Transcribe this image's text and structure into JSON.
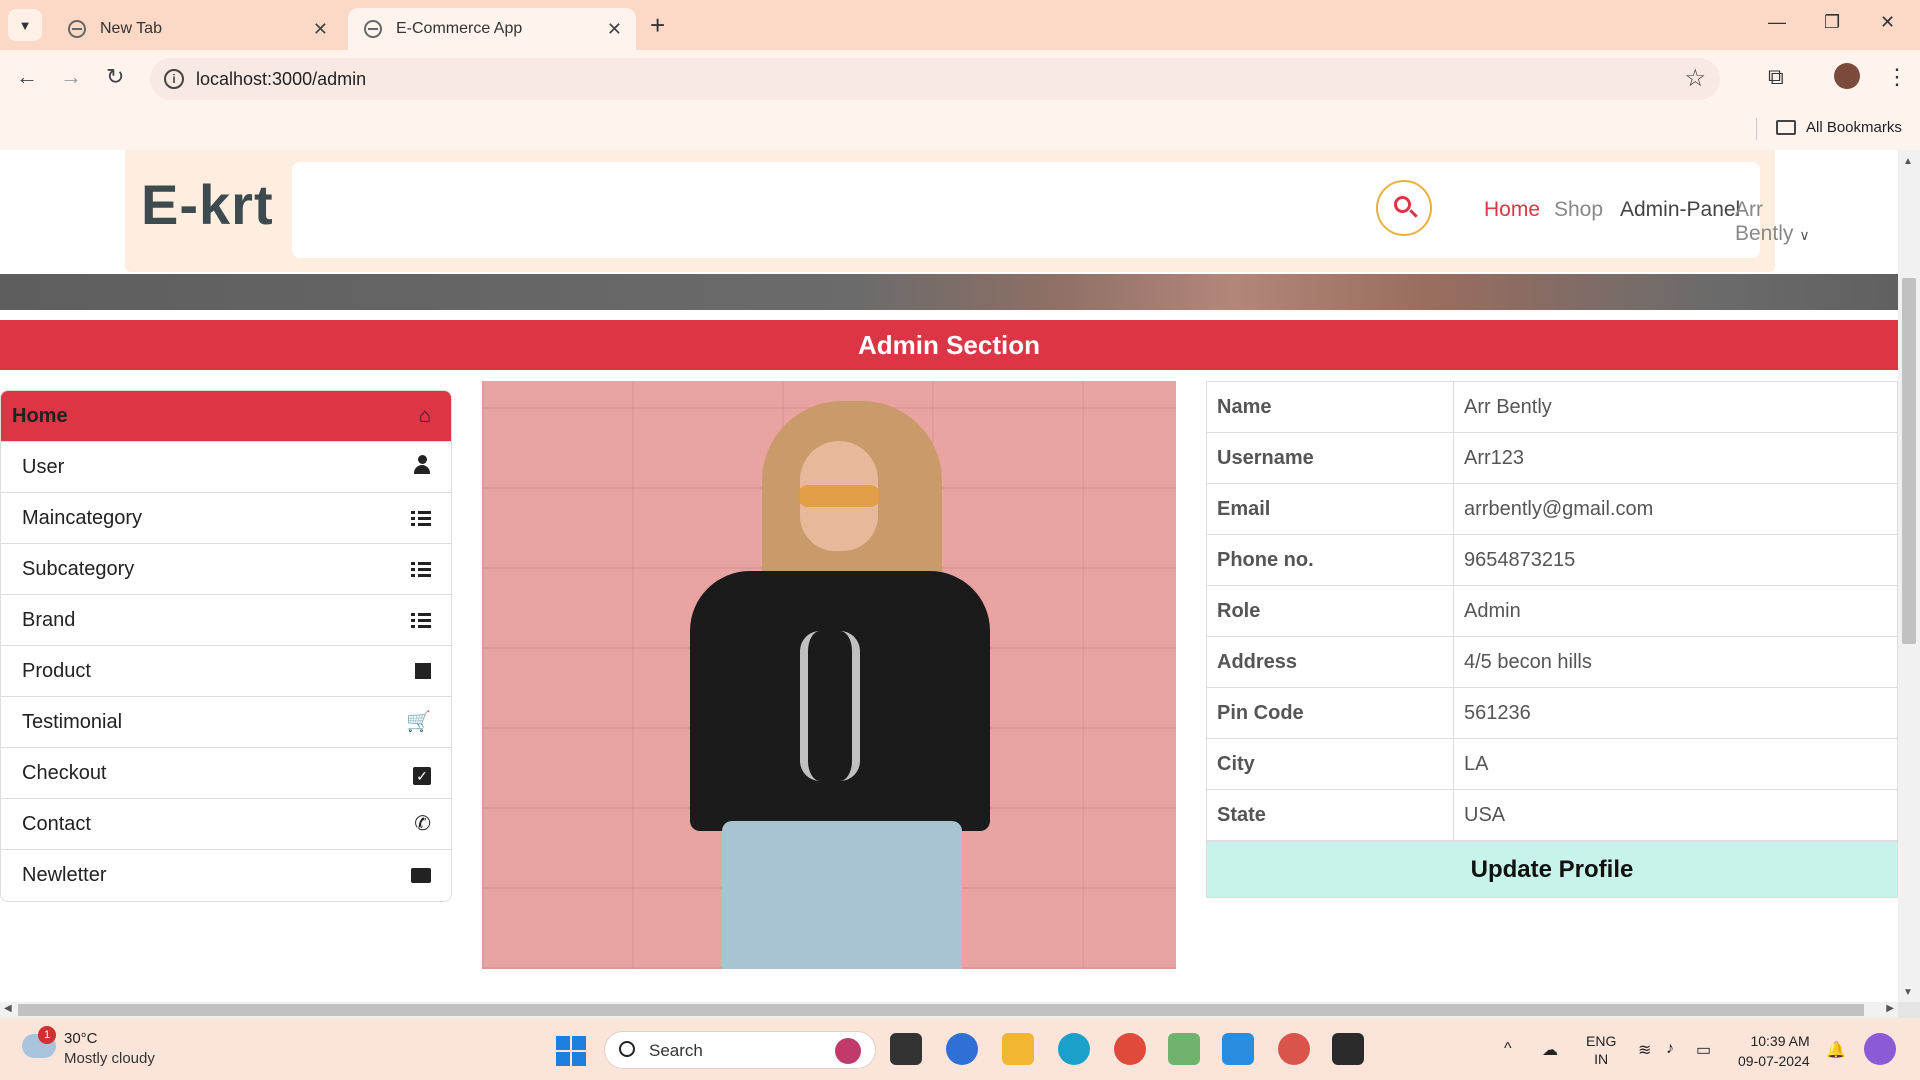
{
  "browser": {
    "tabs": [
      {
        "title": "New Tab"
      },
      {
        "title": "E-Commerce App"
      }
    ],
    "url": "localhost:3000/admin",
    "bookmarks_label": "All Bookmarks"
  },
  "site": {
    "logo": "E-krt",
    "nav": {
      "home": "Home",
      "shop": "Shop",
      "admin": "Admin-Panel",
      "user": "Arr Bently"
    },
    "admin_title": "Admin Section"
  },
  "sidebar": {
    "items": [
      {
        "label": "Home",
        "icon": "home-icon"
      },
      {
        "label": "User",
        "icon": "user-icon"
      },
      {
        "label": "Maincategory",
        "icon": "list-icon"
      },
      {
        "label": "Subcategory",
        "icon": "list-icon"
      },
      {
        "label": "Brand",
        "icon": "list-icon"
      },
      {
        "label": "Product",
        "icon": "square-icon"
      },
      {
        "label": "Testimonial",
        "icon": "cart-icon"
      },
      {
        "label": "Checkout",
        "icon": "checkbox-icon"
      },
      {
        "label": "Contact",
        "icon": "phone-icon"
      },
      {
        "label": "Newletter",
        "icon": "envelope-icon"
      }
    ]
  },
  "profile": {
    "rows": [
      {
        "key": "Name",
        "value": "Arr Bently"
      },
      {
        "key": "Username",
        "value": "Arr123"
      },
      {
        "key": "Email",
        "value": "arrbently@gmail.com"
      },
      {
        "key": "Phone no.",
        "value": "9654873215"
      },
      {
        "key": "Role",
        "value": "Admin"
      },
      {
        "key": "Address",
        "value": "4/5 becon hills"
      },
      {
        "key": "Pin Code",
        "value": "561236"
      },
      {
        "key": "City",
        "value": "LA"
      },
      {
        "key": "State",
        "value": "USA"
      }
    ],
    "update_label": "Update Profile"
  },
  "taskbar": {
    "weather_temp": "30°C",
    "weather_desc": "Mostly cloudy",
    "weather_badge": "1",
    "search_label": "Search",
    "lang_1": "ENG",
    "lang_2": "IN",
    "time": "10:39 AM",
    "date": "09-07-2024"
  },
  "colors": {
    "accent": "#dc3545",
    "header_bg": "#fdeedf",
    "update_btn": "#c8f3ea"
  }
}
